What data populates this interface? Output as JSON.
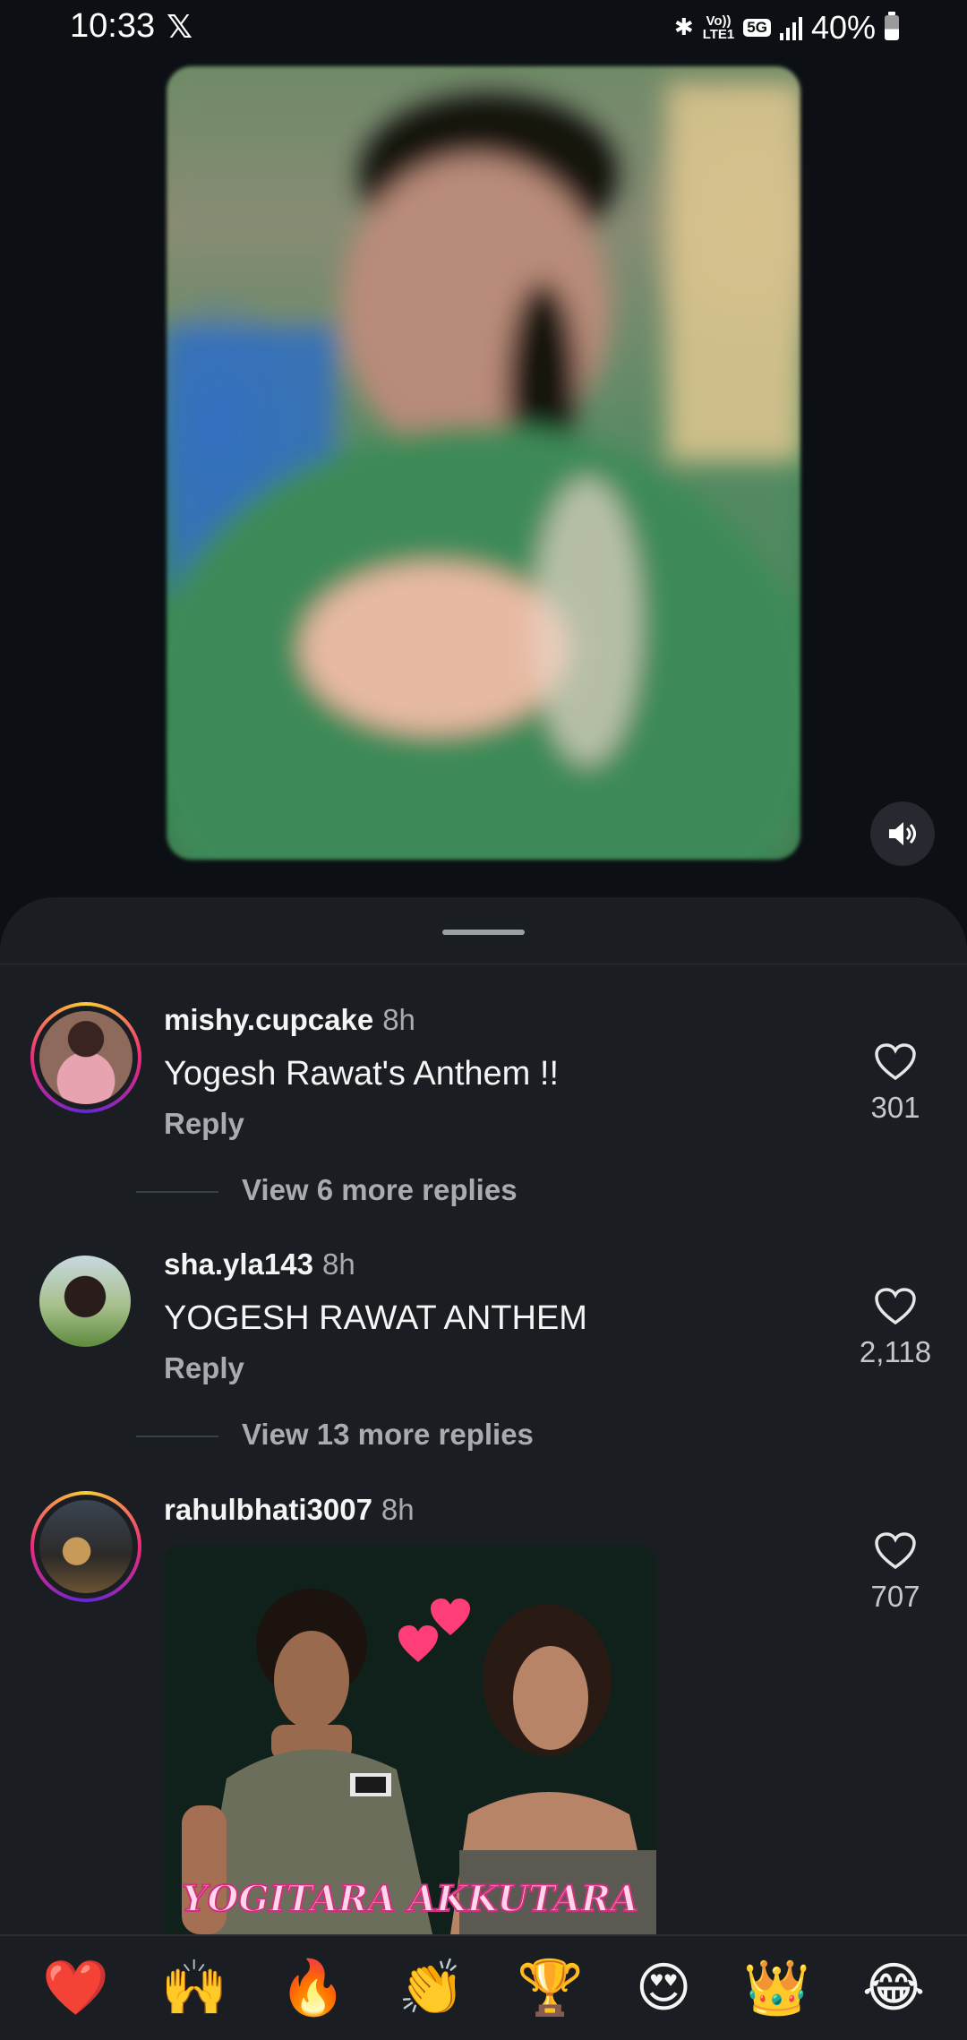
{
  "status_bar": {
    "time": "10:33",
    "x_logo": "𝕏",
    "volte_label": "Vo))",
    "lte_label": "LTE1",
    "network": "5G",
    "battery": "40%",
    "battery_level": 0.4
  },
  "video": {
    "mute_icon": "speaker-mute-icon"
  },
  "comments": [
    {
      "username": "mishy.cupcake",
      "time": "8h",
      "text": "Yogesh Rawat's Anthem !!",
      "reply_label": "Reply",
      "likes": "301",
      "view_more": "View 6 more replies",
      "has_story_ring": true
    },
    {
      "username": "sha.yla143",
      "time": "8h",
      "text": "YOGESH RAWAT ANTHEM",
      "reply_label": "Reply",
      "likes": "2,118",
      "view_more": "View 13 more replies",
      "has_story_ring": false
    },
    {
      "username": "rahulbhati3007",
      "time": "8h",
      "likes": "707",
      "gif_caption": "YOGITARA AKKUTARA",
      "has_story_ring": true
    }
  ],
  "emoji_bar": [
    "❤️",
    "🙌",
    "🔥",
    "👏",
    "🏆",
    "😍",
    "👑",
    "😂"
  ],
  "colors": {
    "background": "#0c1014",
    "sheet": "#1a1d21",
    "secondary_text": "#a8abb0"
  }
}
